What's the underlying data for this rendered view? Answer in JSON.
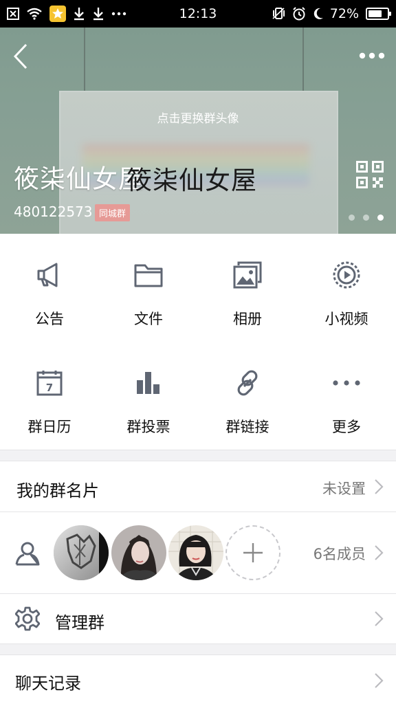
{
  "status_bar": {
    "time": "12:13",
    "battery_text": "72%",
    "battery_level": 0.72,
    "icons": [
      "close-box-icon",
      "wifi-icon",
      "app-star-icon",
      "download-icon",
      "download-icon",
      "more-dots-icon",
      "vibrate-icon",
      "alarm-icon",
      "moon-icon",
      "battery-icon"
    ]
  },
  "header": {
    "change_avatar_text": "点击更换群头像",
    "group_name": "筱柒仙女屋",
    "group_name_overlay": "筱柒仙女屋",
    "group_id": "480122573",
    "badge": "同城群",
    "page_indicator_count": 3,
    "page_indicator_active": 3
  },
  "features": [
    {
      "label": "公告",
      "icon": "megaphone-icon"
    },
    {
      "label": "文件",
      "icon": "folder-icon"
    },
    {
      "label": "相册",
      "icon": "album-icon"
    },
    {
      "label": "小视频",
      "icon": "video-icon"
    },
    {
      "label": "群日历",
      "icon": "calendar-icon"
    },
    {
      "label": "群投票",
      "icon": "vote-chart-icon"
    },
    {
      "label": "群链接",
      "icon": "link-icon"
    },
    {
      "label": "更多",
      "icon": "more-dots-icon"
    }
  ],
  "calendar_day": "7",
  "group_card": {
    "title": "我的群名片",
    "value": "未设置"
  },
  "members": {
    "count_text": "6名成员",
    "icon": "members-icon"
  },
  "manage": {
    "title": "管理群",
    "icon": "gear-icon"
  },
  "chat_history": {
    "title": "聊天记录"
  },
  "colors": {
    "accent_badge": "#e69a96",
    "icon_gray": "#5f6673",
    "header_green": "#8fa99d"
  }
}
